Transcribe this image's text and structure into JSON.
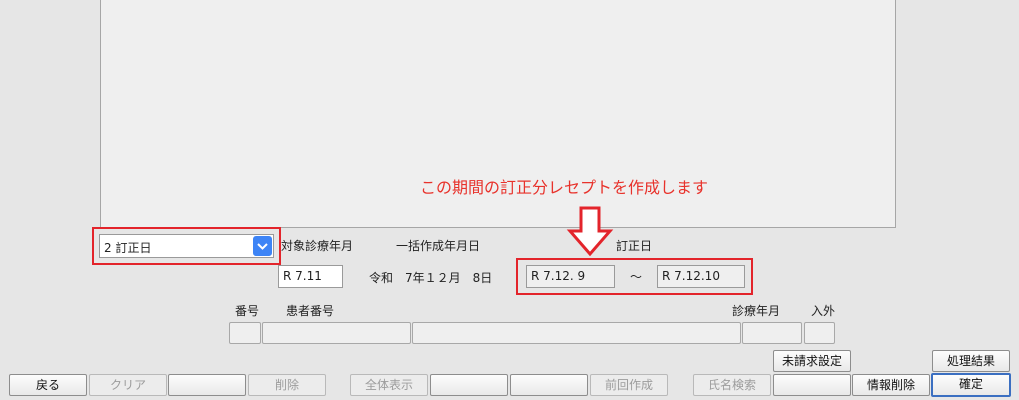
{
  "annotation": {
    "text": "この期間の訂正分レセプトを作成します"
  },
  "select": {
    "value": "2 訂正日"
  },
  "labels": {
    "target_month": "対象診療年月",
    "batch_date": "一括作成年月日",
    "correction_date": "訂正日",
    "number": "番号",
    "patient_number": "患者番号",
    "service_month": "診療年月",
    "inpatient_outpatient": "入外"
  },
  "fields": {
    "target_month": "R 7.11",
    "batch_date": "令和　7年１２月　8日",
    "correction_from": "R 7.12. 9",
    "tilde": "～",
    "correction_to": "R 7.12.10"
  },
  "buttons": {
    "back": "戻る",
    "clear": "クリア",
    "delete": "削除",
    "show_all": "全体表示",
    "previous": "前回作成",
    "name_search": "氏名検索",
    "unbilled_settings": "未請求設定",
    "info_delete": "情報削除",
    "process_result": "処理結果",
    "confirm": "確定"
  },
  "colors": {
    "highlight": "#e3242b",
    "select_button": "#3d84f6",
    "focus_border": "#3b6fc1"
  },
  "icons": {
    "annotation_arrow": "down-arrow-icon",
    "select_toggle": "chevron-down-icon"
  }
}
